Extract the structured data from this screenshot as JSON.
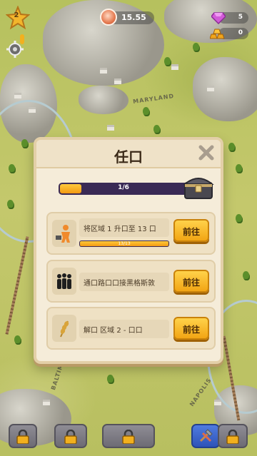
{
  "hud": {
    "level": "2",
    "coins": "15.55",
    "gems": "5",
    "gold": "0"
  },
  "map_labels": [
    "MARYLAND",
    "BALTIMORE",
    "NAPOLIS"
  ],
  "dialog": {
    "title": "任口",
    "progress_text": "1/6",
    "progress_fraction": 0.1667,
    "quests": [
      {
        "text": "将区域 1 升口至 13 口",
        "go_label": "前往",
        "icon": "worker-icon",
        "progress_text": "13/13",
        "progress_fraction": 1.0
      },
      {
        "text": "通口路口口接黑格斯敦",
        "go_label": "前往",
        "icon": "people-icon"
      },
      {
        "text": "解口 区域 2 - 口口",
        "go_label": "前往",
        "icon": "wheat-icon"
      }
    ]
  },
  "bottom_bar": [
    "lock-icon",
    "lock-icon",
    "lock-icon",
    "build-tools-icon",
    "lock-icon"
  ],
  "colors": {
    "accent": "#f2a514",
    "progress_track": "#3a2a55",
    "panel": "#f5ecd9"
  }
}
